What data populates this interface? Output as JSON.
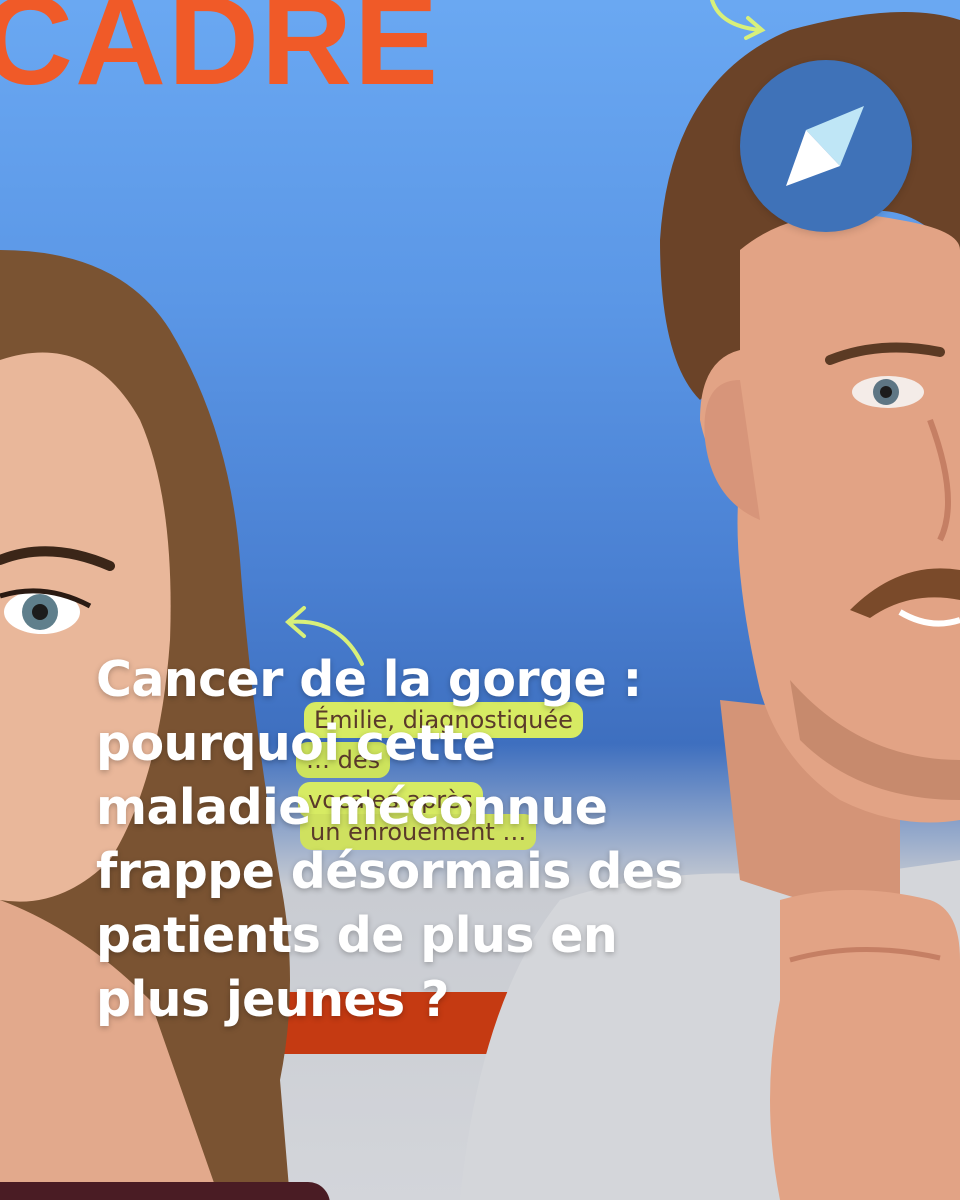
{
  "background": {
    "heading_fragment": "CADRE",
    "card_text": [
      "Émilie, diagnostiquée",
      "… des",
      "vocales après",
      "un enrouement …"
    ]
  },
  "post": {
    "headline_lines": [
      "Cancer de la gorge :",
      "pourquoi cette",
      "maladie méconnue",
      "frappe désormais des",
      "patients de plus en",
      "plus jeunes ?"
    ]
  },
  "brand": {
    "logo_icon": "publisher-logo-icon",
    "logo_color": "#3f72b8"
  },
  "colors": {
    "headline": "#ffffff",
    "background_word": "#f05a28",
    "band": "#c53a12",
    "chip": "#d7eb63"
  }
}
